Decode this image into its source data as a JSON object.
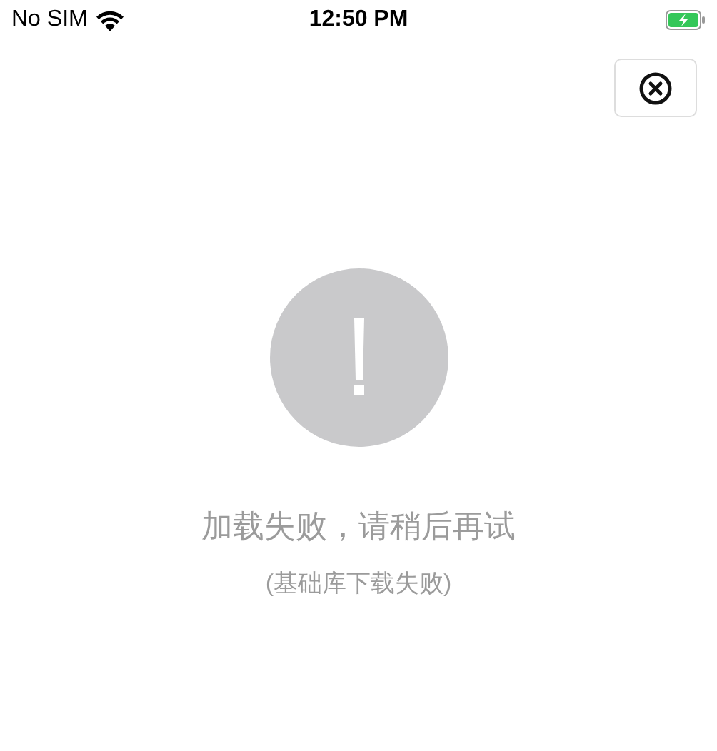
{
  "status_bar": {
    "carrier": "No SIM",
    "time": "12:50 PM"
  },
  "error": {
    "message": "加载失败，请稍后再试",
    "detail": "(基础库下载失败)"
  }
}
